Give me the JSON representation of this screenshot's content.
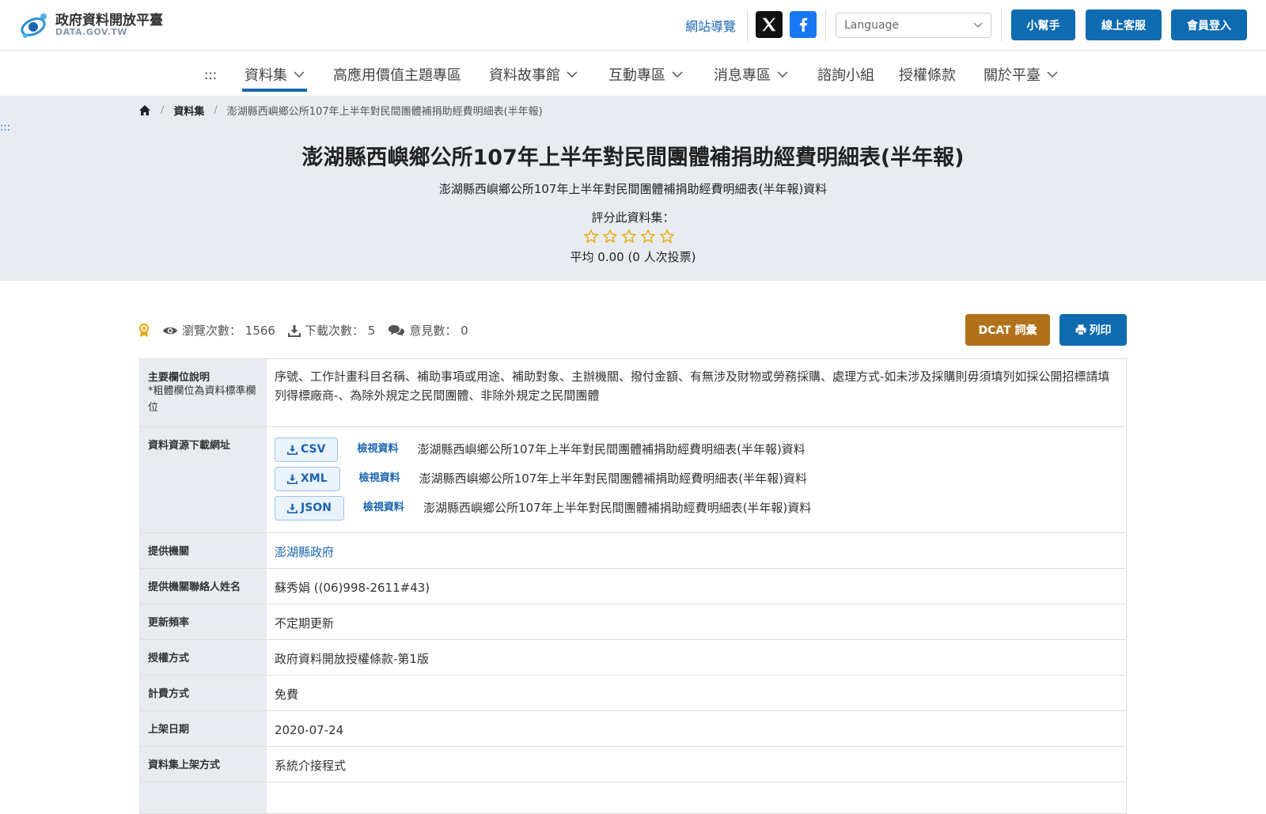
{
  "header": {
    "logo_cn": "政府資料開放平臺",
    "logo_en": "DATA.GOV.TW",
    "sitemap": "網站導覽",
    "language_placeholder": "Language",
    "buttons": {
      "helper": "小幫手",
      "support": "線上客服",
      "login": "會員登入"
    }
  },
  "nav": {
    "accesskey": ":::",
    "items": [
      {
        "label": "資料集"
      },
      {
        "label": "高應用價值主題專區"
      },
      {
        "label": "資料故事館"
      },
      {
        "label": "互動專區"
      },
      {
        "label": "消息專區"
      },
      {
        "label": "諮詢小組"
      },
      {
        "label": "授權條款"
      },
      {
        "label": "關於平臺"
      }
    ]
  },
  "breadcrumb": {
    "sep": "/",
    "level1": "資料集",
    "current": "澎湖縣西嶼鄉公所107年上半年對民間團體補捐助經費明細表(半年報)"
  },
  "hero": {
    "accesskey": ":::",
    "title": "澎湖縣西嶼鄉公所107年上半年對民間團體補捐助經費明細表(半年報)",
    "subtitle": "澎湖縣西嶼鄉公所107年上半年對民間團體補捐助經費明細表(半年報)資料",
    "rate_label": "評分此資料集：",
    "stars": 0,
    "average": "平均 0.00 (0 人次投票)"
  },
  "stats": {
    "views_label": "瀏覽次數：",
    "views": "1566",
    "downloads_label": "下載次數：",
    "downloads": "5",
    "comments_label": "意見數：",
    "comments": "0",
    "dcat_button": "DCAT 詞彙",
    "print_button": "列印"
  },
  "info": {
    "fields": {
      "label": "主要欄位說明",
      "note": "*粗體欄位為資料標準欄位",
      "value": "序號、工作計畫科目名稱、補助事項或用途、補助對象、主辦機關、撥付金額、有無涉及財物或勞務採購、處理方式-如未涉及採購則毋須填列如採公開招標請填列得標廠商-、為除外規定之民間團體、非除外規定之民間團體"
    },
    "resources": {
      "label": "資料資源下載網址",
      "view_label": "檢視資料",
      "items": [
        {
          "format": "CSV",
          "desc": "澎湖縣西嶼鄉公所107年上半年對民間團體補捐助經費明細表(半年報)資料"
        },
        {
          "format": "XML",
          "desc": "澎湖縣西嶼鄉公所107年上半年對民間團體補捐助經費明細表(半年報)資料"
        },
        {
          "format": "JSON",
          "desc": "澎湖縣西嶼鄉公所107年上半年對民間團體補捐助經費明細表(半年報)資料"
        }
      ]
    },
    "provider": {
      "label": "提供機關",
      "value": "澎湖縣政府"
    },
    "contact": {
      "label": "提供機關聯絡人姓名",
      "value": "蘇秀娟 ((06)998-2611#43)"
    },
    "frequency": {
      "label": "更新頻率",
      "value": "不定期更新"
    },
    "license": {
      "label": "授權方式",
      "value": "政府資料開放授權條款-第1版"
    },
    "fee": {
      "label": "計費方式",
      "value": "免費"
    },
    "published": {
      "label": "上架日期",
      "value": "2020-07-24"
    },
    "method": {
      "label": "資料集上架方式",
      "value": "系統介接程式"
    }
  },
  "colors": {
    "primary": "#0e6bb0",
    "link": "#1a66b0",
    "dcat": "#b0711a",
    "hero_bg": "#e8ecf1",
    "star": "#e6a700"
  }
}
